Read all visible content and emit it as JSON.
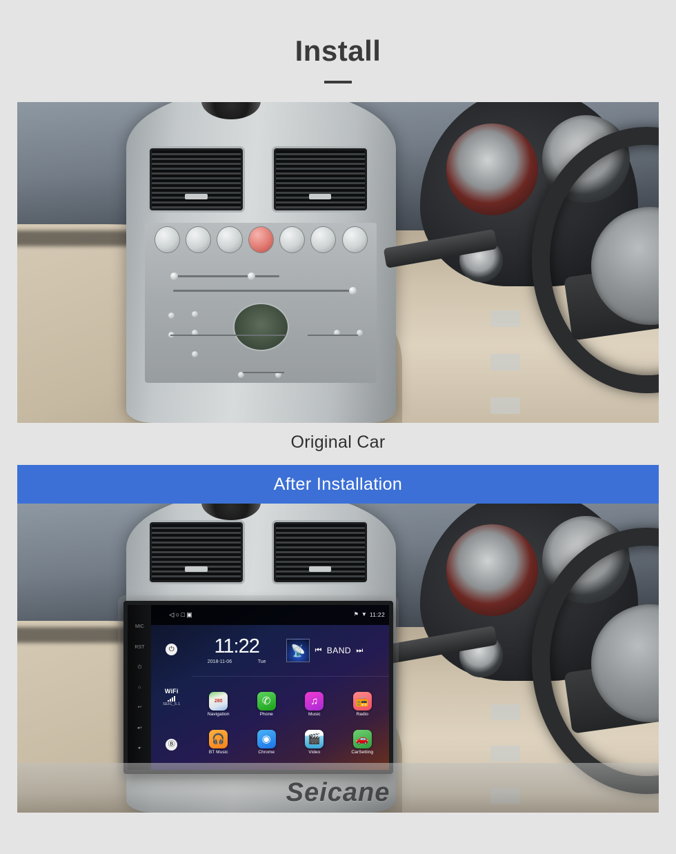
{
  "header": {
    "title": "Install"
  },
  "sections": {
    "original": {
      "caption": "Original Car"
    },
    "after": {
      "banner_label": "After  Installation",
      "banner_color": "#3c70d6",
      "watermark": "Seicane"
    }
  },
  "head_unit": {
    "bezel_buttons": [
      {
        "name": "mic-button",
        "label": "MIC"
      },
      {
        "name": "reset-button",
        "label": "RST"
      },
      {
        "name": "power-button",
        "label": "⏻"
      },
      {
        "name": "home-button",
        "label": "⌂"
      },
      {
        "name": "back-button",
        "label": "↩"
      },
      {
        "name": "volume-up-button",
        "label": "◂+"
      },
      {
        "name": "volume-down-button",
        "label": "◂-"
      }
    ],
    "status_bar": {
      "nav_back": "◁",
      "nav_home": "○",
      "nav_recents": "□",
      "nav_extra": "▣",
      "location_icon": "⚑",
      "wifi_icon": "▼",
      "clock": "11:22"
    },
    "side_panel": {
      "power_icon": "⏻",
      "wifi_label": "WiFi",
      "wifi_ssid": "SEIC_5.1",
      "bluetooth_icon": "Ⓑ"
    },
    "clock_widget": {
      "time": "11:22",
      "date": "2018-11-06",
      "weekday": "Tue"
    },
    "media_widget": {
      "album_icon": "὏B",
      "prev_label": "⏮",
      "band_label": "BAND",
      "next_label": "⏭"
    },
    "apps": [
      {
        "label": "Navigation",
        "icon": "map-icon",
        "badge": "280",
        "class": "ic-nav"
      },
      {
        "label": "Phone",
        "icon": "phone-icon",
        "badge": "✆",
        "class": "ic-phone"
      },
      {
        "label": "Music",
        "icon": "music-note-icon",
        "badge": "♫",
        "class": "ic-music"
      },
      {
        "label": "Radio",
        "icon": "radio-icon",
        "badge": "὏B",
        "class": "ic-radio"
      },
      {
        "label": "BT Music",
        "icon": "bluetooth-headset-icon",
        "badge": "฿",
        "class": "ic-bt"
      },
      {
        "label": "Chrome",
        "icon": "chrome-icon",
        "badge": "◉",
        "class": "ic-chrome"
      },
      {
        "label": "Video",
        "icon": "clapperboard-icon",
        "badge": "▶",
        "class": "ic-video"
      },
      {
        "label": "CarSetting",
        "icon": "car-gear-icon",
        "badge": "⚙",
        "class": "ic-car"
      }
    ]
  }
}
